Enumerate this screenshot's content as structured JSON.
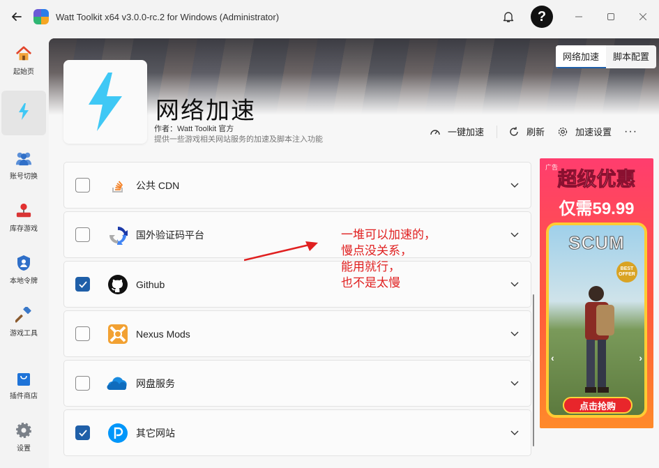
{
  "window": {
    "title": "Watt Toolkit x64 v3.0.0-rc.2 for Windows (Administrator)"
  },
  "sidebar": {
    "items": [
      {
        "label": "起始页",
        "icon": "home-icon"
      },
      {
        "label": "",
        "icon": "lightning-icon"
      },
      {
        "label": "账号切换",
        "icon": "users-icon"
      },
      {
        "label": "库存游戏",
        "icon": "joystick-icon"
      },
      {
        "label": "本地令牌",
        "icon": "shield-user-icon"
      },
      {
        "label": "游戏工具",
        "icon": "hammer-icon"
      },
      {
        "label": "插件商店",
        "icon": "shopping-bag-icon"
      },
      {
        "label": "设置",
        "icon": "gear-icon"
      }
    ],
    "active_index": 1
  },
  "tabs": [
    {
      "label": "网络加速",
      "active": true
    },
    {
      "label": "脚本配置",
      "active": false
    }
  ],
  "plugin": {
    "title": "网络加速",
    "author": "作者：Watt Toolkit 官方",
    "description": "提供一些游戏相关网站服务的加速及脚本注入功能"
  },
  "actions": {
    "one_click": "一键加速",
    "refresh": "刷新",
    "settings": "加速设置",
    "more": "···"
  },
  "services": [
    {
      "name": "公共 CDN",
      "checked": false,
      "icon": "stackoverflow-icon"
    },
    {
      "name": "国外验证码平台",
      "checked": false,
      "icon": "recaptcha-icon"
    },
    {
      "name": "Github",
      "checked": true,
      "icon": "github-icon"
    },
    {
      "name": "Nexus Mods",
      "checked": false,
      "icon": "nexus-mods-icon"
    },
    {
      "name": "网盘服务",
      "checked": false,
      "icon": "onedrive-icon"
    },
    {
      "name": "其它网站",
      "checked": true,
      "icon": "pixiv-icon"
    }
  ],
  "annotation": {
    "lines": [
      "一堆可以加速的，",
      "慢点没关系，",
      "能用就行，",
      "也不是太慢"
    ],
    "color": "#e02020"
  },
  "ad": {
    "tag": "广告",
    "headline": "超级优惠",
    "price": "仅需59.99",
    "game": "SCUM",
    "badge": "BEST OFFER",
    "cta": "点击抢购"
  },
  "colors": {
    "accent": "#1f5fa8",
    "lightning": "#3fc8f5"
  }
}
